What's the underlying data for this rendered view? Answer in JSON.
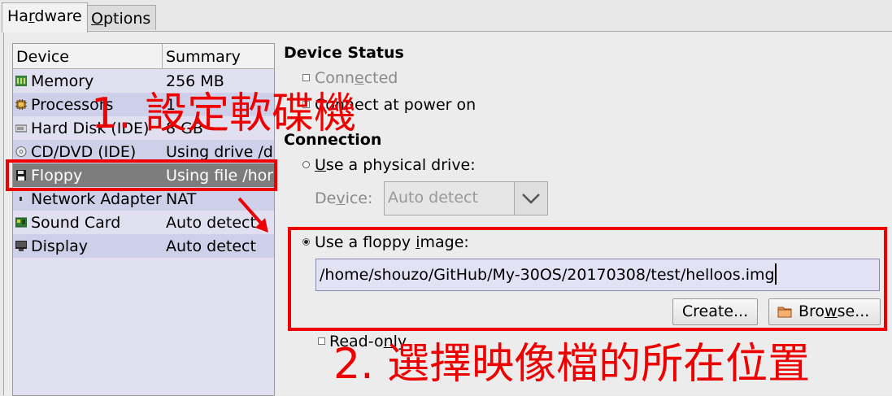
{
  "tabs": [
    {
      "pre": "Ha",
      "mn": "r",
      "post": "dware"
    },
    {
      "pre": "",
      "mn": "O",
      "post": "ptions"
    }
  ],
  "device_list": {
    "col_device": "Device",
    "col_summary": "Summary",
    "rows": [
      {
        "name": "Memory",
        "summary": "256 MB",
        "icon": "memory-icon"
      },
      {
        "name": "Processors",
        "summary": "1",
        "icon": "processor-icon"
      },
      {
        "name": "Hard Disk (IDE)",
        "summary": "8 GB",
        "icon": "hard-disk-icon"
      },
      {
        "name": "CD/DVD (IDE)",
        "summary": "Using drive /d",
        "icon": "cd-icon"
      },
      {
        "name": "Floppy",
        "summary": "Using file /hor",
        "icon": "floppy-icon"
      },
      {
        "name": "Network Adapter",
        "summary": "NAT",
        "icon": "network-icon"
      },
      {
        "name": "Sound Card",
        "summary": "Auto detect",
        "icon": "sound-card-icon"
      },
      {
        "name": "Display",
        "summary": "Auto detect",
        "icon": "display-icon"
      }
    ]
  },
  "device_status": {
    "title": "Device Status",
    "connected": {
      "pre": "Conn",
      "mn": "e",
      "post": "cted"
    },
    "connect_at_power_on": {
      "pre": "Connect at power on"
    }
  },
  "connection": {
    "title": "Connection",
    "use_physical": {
      "pre": "",
      "mn": "U",
      "post": "se a physical drive:"
    },
    "device_label": {
      "pre": "De",
      "mn": "v",
      "post": "ice:"
    },
    "device_value": "Auto detect",
    "use_image": {
      "pre": "Use a floppy ",
      "mn": "i",
      "post": "mage:"
    },
    "image_path": "/home/shouzo/GitHub/My-30OS/20170308/test/helloos.img",
    "create": {
      "pre": "Create..."
    },
    "browse": {
      "pre": "Bro",
      "mn": "w",
      "post": "se..."
    },
    "read_only": {
      "pre": "Read-o",
      "mn": "n",
      "post": "ly"
    }
  },
  "annotations": {
    "step1": "1.  設定軟碟機",
    "step2": "2.  選擇映像檔的所在位置",
    "color": "#ee0000"
  }
}
